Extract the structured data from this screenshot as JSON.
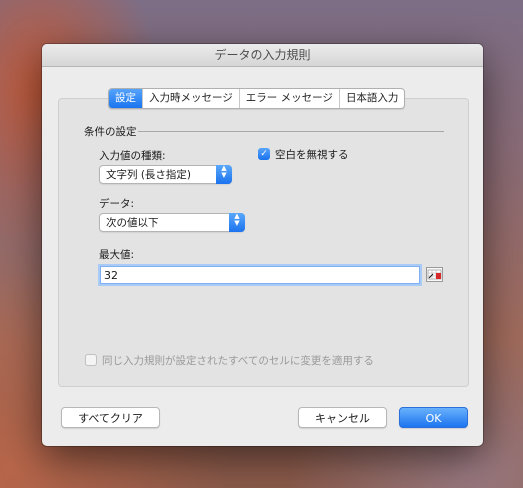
{
  "dialog": {
    "title": "データの入力規則"
  },
  "tabs": [
    {
      "label": "設定",
      "active": true
    },
    {
      "label": "入力時メッセージ",
      "active": false
    },
    {
      "label": "エラー メッセージ",
      "active": false
    },
    {
      "label": "日本語入力",
      "active": false
    }
  ],
  "settings": {
    "section_title": "条件の設定",
    "allow_label": "入力値の種類:",
    "allow_value": "文字列 (長さ指定)",
    "ignore_blank_label": "空白を無視する",
    "ignore_blank_checked": true,
    "data_label": "データ:",
    "data_value": "次の値以下",
    "max_label": "最大値:",
    "max_value": "32",
    "apply_all_label": "同じ入力規則が設定されたすべてのセルに変更を適用する",
    "apply_all_checked": false
  },
  "buttons": {
    "clear_all": "すべてクリア",
    "cancel": "キャンセル",
    "ok": "OK"
  },
  "colors": {
    "accent": "#1a74ef",
    "disabled_text": "#9a9a9a"
  },
  "icons": {
    "popup_arrows": "chevron-up-down-icon",
    "cell_reference": "range-select-icon"
  }
}
